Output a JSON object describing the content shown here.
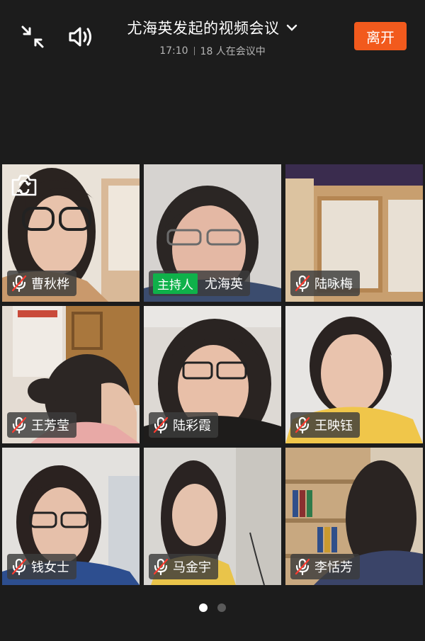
{
  "header": {
    "meeting_title": "尤海英发起的视频会议",
    "time": "17:10",
    "participant_count": "18 人在会议中",
    "leave_label": "离开",
    "leave_color": "#f25a1d"
  },
  "icons": {
    "collapse": "collapse-arrows-icon",
    "speaker": "speaker-icon",
    "chevron": "chevron-down-icon",
    "mic_muted": "mic-muted-icon",
    "camera_switch": "camera-switch-icon"
  },
  "host_badge": "主持人",
  "participants": [
    {
      "name": "曹秋桦",
      "muted": true,
      "host": false
    },
    {
      "name": "尤海英",
      "muted": false,
      "host": true
    },
    {
      "name": "陆咏梅",
      "muted": true,
      "host": false
    },
    {
      "name": "王芳莹",
      "muted": true,
      "host": false
    },
    {
      "name": "陆彩霞",
      "muted": true,
      "host": false
    },
    {
      "name": "王映钰",
      "muted": true,
      "host": false
    },
    {
      "name": "钱女士",
      "muted": true,
      "host": false
    },
    {
      "name": "马金宇",
      "muted": true,
      "host": false
    },
    {
      "name": "李恬芳",
      "muted": true,
      "host": false
    }
  ],
  "pagination": {
    "pages": 2,
    "current": 1
  }
}
